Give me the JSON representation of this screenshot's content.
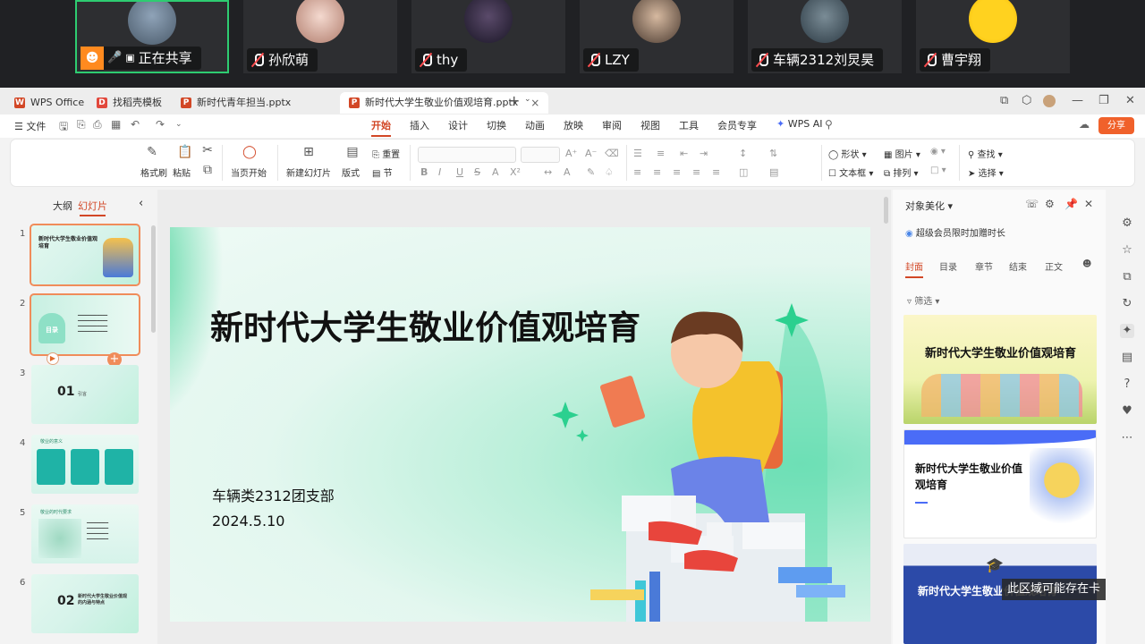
{
  "meeting": {
    "participants": [
      {
        "name": "正在共享",
        "status": "sharing",
        "active": true
      },
      {
        "name": "孙欣萌",
        "status": "muted"
      },
      {
        "name": "thy",
        "status": "muted"
      },
      {
        "name": "LZY",
        "status": "muted"
      },
      {
        "name": "车辆2312刘炅昊",
        "status": "muted"
      },
      {
        "name": "曹宇翔",
        "status": "muted"
      }
    ]
  },
  "titlebar": {
    "tabs": [
      {
        "label": "WPS Office",
        "icon": "wps-icon",
        "color": "#d24726"
      },
      {
        "label": "找稻壳模板",
        "icon": "docer-icon",
        "color": "#e2483c"
      },
      {
        "label": "新时代青年担当.pptx",
        "icon": "ppt-icon",
        "color": "#d24726"
      },
      {
        "label": "新时代大学生敬业价值观培育.pptx",
        "icon": "ppt-icon",
        "color": "#d24726",
        "active": true
      }
    ],
    "new_tab": "+"
  },
  "menu": {
    "file_label": "文件",
    "tabs": [
      "开始",
      "插入",
      "设计",
      "切换",
      "动画",
      "放映",
      "审阅",
      "视图",
      "工具",
      "会员专享"
    ],
    "active_tab": "开始",
    "wps_ai": "WPS AI",
    "share": "分享"
  },
  "ribbon": {
    "format_painter": "格式刷",
    "paste": "粘贴",
    "play_current": "当页开始",
    "new_slide": "新建幻灯片",
    "layout": "版式",
    "reset": "重置",
    "section": "节",
    "shapes": "形状",
    "picture": "图片",
    "textbox": "文本框",
    "arrange": "排列",
    "find": "查找",
    "select": "选择",
    "bold": "B",
    "italic": "I",
    "underline": "U",
    "strike": "S"
  },
  "left_panel": {
    "tabs": [
      "大纲",
      "幻灯片"
    ],
    "active_tab": "幻灯片",
    "slides": [
      {
        "num": "1",
        "title": "新时代大学生敬业价值观培育",
        "selected": true
      },
      {
        "num": "2",
        "title": "目录",
        "selected": false
      },
      {
        "num": "3",
        "big": "01",
        "title": "引言",
        "selected": false
      },
      {
        "num": "4",
        "title": "敬业的意义",
        "selected": false
      },
      {
        "num": "5",
        "title": "敬业的时代要求",
        "selected": false
      },
      {
        "num": "6",
        "big": "02",
        "title": "新时代大学生敬业价值观的内涵与特点",
        "selected": false
      }
    ]
  },
  "slide": {
    "title": "新时代大学生敬业价值观培育",
    "subtitle": "车辆类2312团支部",
    "date": "2024.5.10"
  },
  "right_panel": {
    "title": "对象美化",
    "member_text": "超级会员限时加赠时长",
    "tabs": [
      "封面",
      "目录",
      "章节",
      "结束",
      "正文"
    ],
    "active_tab": "封面",
    "filter": "筛选",
    "templates": [
      {
        "title": "新时代大学生敬业价值观培育"
      },
      {
        "title": "新时代大学生敬业价值观培育"
      },
      {
        "title": "新时代大学生敬业价值观培育"
      }
    ],
    "tooltip": "此区域可能存在卡"
  },
  "colors": {
    "accent": "#d24726",
    "share_button": "#f0612b",
    "slide_green": "#3ddc97"
  }
}
